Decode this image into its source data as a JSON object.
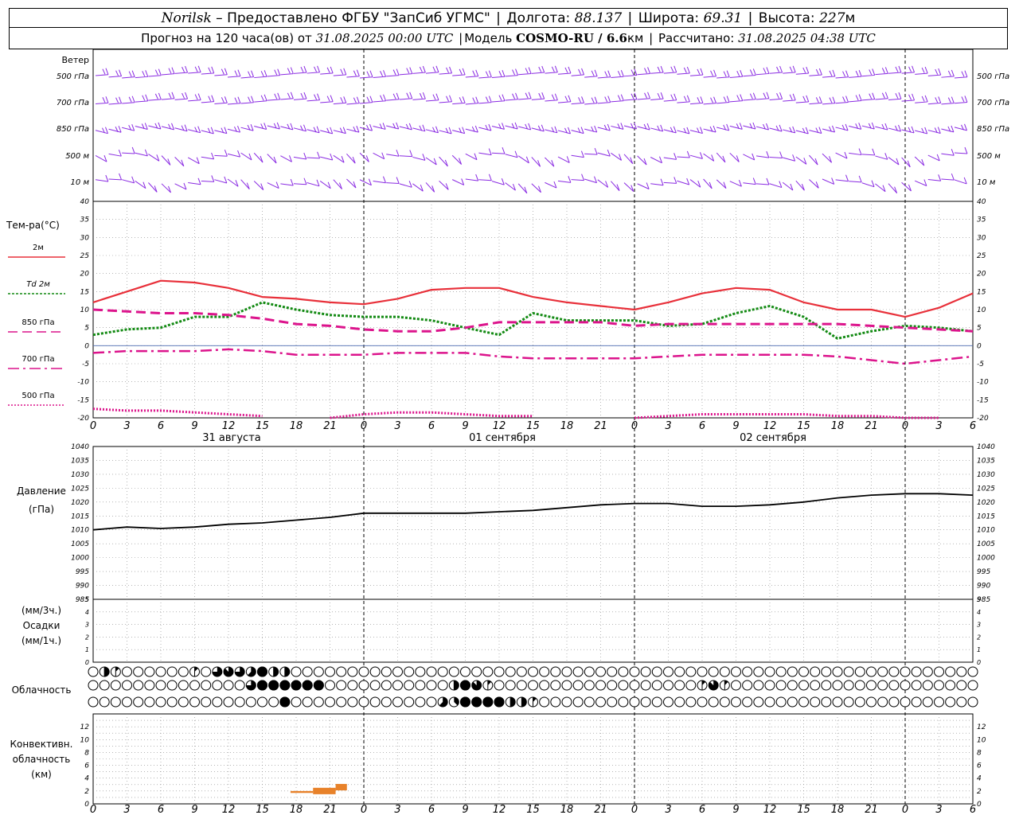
{
  "header": {
    "line1": {
      "station": "Norilsk",
      "dash": " – ",
      "provider": "Предоставлено ФГБУ \"ЗапСиб УГМС\"",
      "lon_label": "Долгота:",
      "lon_value": "88.137",
      "lat_label": "Широта:",
      "lat_value": "69.31",
      "alt_label": "Высота:",
      "alt_value": "227",
      "alt_unit": "м"
    },
    "line2": {
      "forecast_label": "Прогноз на 120 часа(ов) от",
      "forecast_start": "31.08.2025 00:00 UTC",
      "model_label": "Модель",
      "model_name": "COSMO-RU / 6.6",
      "model_unit": "км",
      "computed_label": "Рассчитано:",
      "computed_value": "31.08.2025 04:38 UTC"
    }
  },
  "wind_panel": {
    "title": "Ветер",
    "levels": [
      "500 гПа",
      "700 гПа",
      "850 гПа",
      "500 м",
      "10  м"
    ],
    "barb_color": "#8a2be2"
  },
  "chart_data": [
    {
      "type": "line",
      "panel": "temperature",
      "ylabel": "Тем-ра(°C)",
      "ylim": [
        -20,
        40
      ],
      "yticks": [
        "40",
        "35",
        "30",
        "25",
        "20",
        "15",
        "10",
        "5",
        "0",
        "-5",
        "-10",
        "-15",
        "-20"
      ],
      "x": [
        0,
        3,
        6,
        9,
        12,
        15,
        18,
        21,
        24,
        27,
        30,
        33,
        36,
        39,
        42,
        45,
        48,
        51,
        54,
        57,
        60,
        63,
        66,
        69,
        72,
        75,
        78
      ],
      "x_tick_labels": [
        "0",
        "3",
        "6",
        "9",
        "12",
        "15",
        "18",
        "21",
        "0",
        "3",
        "6",
        "9",
        "12",
        "15",
        "18",
        "21",
        "0",
        "3",
        "6",
        "9",
        "12",
        "15",
        "18",
        "21",
        "0",
        "3",
        "6"
      ],
      "day_labels": [
        "31 августа",
        "01 сентября",
        "02 сентября"
      ],
      "series": [
        {
          "name": "2м",
          "color": "#e8303a",
          "style": "solid",
          "values": [
            12,
            15,
            18,
            17.5,
            16,
            13.5,
            13,
            12,
            11.5,
            13,
            15.5,
            16,
            16,
            13.5,
            12,
            11,
            10,
            12,
            14.5,
            16,
            15.5,
            12,
            10,
            10,
            8,
            10.5,
            14.5
          ]
        },
        {
          "name": "Td 2м",
          "color": "#138a13",
          "style": "dotted",
          "values": [
            3,
            4.5,
            5,
            8,
            8,
            12,
            10,
            8.5,
            8,
            8,
            7,
            5,
            3,
            9,
            7,
            7,
            7,
            5.5,
            6,
            9,
            11,
            8,
            2,
            4,
            5.5,
            5,
            4
          ]
        },
        {
          "name": "850 гПа",
          "color": "#dc148c",
          "style": "dashed",
          "values": [
            10,
            9.5,
            9,
            9,
            8.5,
            7.5,
            6,
            5.5,
            4.5,
            4,
            4,
            5,
            6.5,
            6.5,
            6.5,
            6.5,
            5.5,
            6,
            6,
            6,
            6,
            6,
            6,
            5.5,
            5,
            4.5,
            4
          ]
        },
        {
          "name": "700 гПа",
          "color": "#dc148c",
          "style": "dashdot",
          "values": [
            -2,
            -1.5,
            -1.5,
            -1.5,
            -1,
            -1.5,
            -2.5,
            -2.5,
            -2.5,
            -2,
            -2,
            -2,
            -3,
            -3.5,
            -3.5,
            -3.5,
            -3.5,
            -3,
            -2.5,
            -2.5,
            -2.5,
            -2.5,
            -3,
            -4,
            -5,
            -4,
            -3
          ]
        },
        {
          "name": "500 гПа",
          "color": "#dc148c",
          "style": "dotted-fine",
          "values": [
            -17.5,
            -18,
            -18,
            -18.5,
            -19,
            -19.5,
            null,
            -20,
            -19,
            -18.5,
            -18.5,
            -19,
            -19.5,
            -19.5,
            null,
            null,
            -20,
            -19.5,
            -19,
            -19,
            -19,
            -19,
            -19.5,
            -19.5,
            -20,
            -20,
            null
          ]
        }
      ]
    },
    {
      "type": "line",
      "panel": "pressure",
      "ylabel": "Давление",
      "yunit": "(гПа)",
      "ylim": [
        985,
        1040
      ],
      "yticks": [
        "1040",
        "1035",
        "1030",
        "1025",
        "1020",
        "1015",
        "1010",
        "1005",
        "1000",
        "995",
        "990",
        "985"
      ],
      "x": [
        0,
        3,
        6,
        9,
        12,
        15,
        18,
        21,
        24,
        27,
        30,
        33,
        36,
        39,
        42,
        45,
        48,
        51,
        54,
        57,
        60,
        63,
        66,
        69,
        72,
        75,
        78
      ],
      "series": [
        {
          "name": "Давление",
          "color": "#000000",
          "values": [
            1010,
            1011,
            1010.5,
            1011,
            1012,
            1012.5,
            1013.5,
            1014.5,
            1016,
            1016,
            1016,
            1016,
            1016.5,
            1017,
            1018,
            1019,
            1019.5,
            1019.5,
            1018.5,
            1018.5,
            1019,
            1020,
            1021.5,
            1022.5,
            1023,
            1023,
            1022.5
          ]
        }
      ]
    },
    {
      "type": "bar",
      "panel": "precipitation",
      "ylabel_lines": [
        "(мм/3ч.)",
        "Осадки",
        "(мм/1ч.)"
      ],
      "ylim": [
        0,
        5
      ],
      "yticks": [
        "5",
        "4",
        "3",
        "2",
        "1",
        "0"
      ],
      "values": []
    },
    {
      "type": "table",
      "panel": "cloudiness",
      "ylabel": "Облачность",
      "hours": [
        0,
        1,
        2,
        3,
        4,
        5,
        6,
        7,
        8,
        9,
        10,
        11,
        12,
        13,
        14,
        15,
        16,
        17,
        18,
        19,
        20,
        21,
        22,
        23,
        24,
        25,
        26,
        27,
        28,
        29,
        30,
        31,
        32,
        33,
        34,
        35,
        36,
        37,
        38,
        39,
        40,
        41,
        42,
        43,
        44,
        45,
        46,
        47,
        48,
        49,
        50,
        51,
        52,
        53,
        54,
        55,
        56,
        57,
        58,
        59,
        60,
        61,
        62,
        63,
        64,
        65,
        66,
        67,
        68,
        69,
        70,
        71,
        72,
        73,
        74,
        75,
        76,
        77,
        78
      ],
      "rows": [
        [
          0,
          0.5,
          0.125,
          0,
          0,
          0,
          0,
          0,
          0,
          0.125,
          0,
          0.75,
          0.875,
          0.75,
          0.625,
          1,
          0.5,
          0.5,
          0,
          0,
          0,
          0,
          0,
          0,
          0,
          0,
          0,
          0,
          0,
          0,
          0,
          0,
          0,
          0,
          0,
          0,
          0,
          0,
          0,
          0,
          0,
          0,
          0,
          0,
          0,
          0,
          0,
          0,
          0,
          0,
          0,
          0,
          0,
          0,
          0,
          0,
          0,
          0,
          0,
          0,
          0,
          0,
          0,
          0,
          0,
          0,
          0,
          0,
          0,
          0,
          0,
          0,
          0,
          0,
          0,
          0,
          0,
          0,
          0
        ],
        [
          0,
          0,
          0,
          0,
          0,
          0,
          0,
          0,
          0,
          0,
          0,
          0,
          0,
          0,
          0.75,
          1,
          1,
          1,
          1,
          1,
          1,
          0,
          0,
          0,
          0,
          0,
          0,
          0,
          0,
          0,
          0,
          0,
          0.5,
          1,
          0.875,
          0.125,
          0,
          0,
          0,
          0,
          0,
          0,
          0,
          0,
          0,
          0,
          0,
          0,
          0,
          0,
          0,
          0,
          0,
          0,
          0.125,
          0.875,
          0.125,
          0,
          0,
          0,
          0,
          0,
          0,
          0,
          0,
          0,
          0,
          0,
          0,
          0,
          0,
          0,
          0,
          0,
          0,
          0,
          0,
          0,
          0
        ],
        [
          0,
          0,
          0,
          0,
          0,
          0,
          0,
          0,
          0,
          0,
          0,
          0,
          0,
          0,
          0,
          0,
          0,
          1,
          0,
          0,
          0,
          0,
          0,
          0,
          0,
          0,
          0,
          0,
          0,
          0,
          0,
          0.625,
          0.375,
          1,
          1,
          1,
          1,
          0.5,
          0.5,
          0.125,
          0,
          0,
          0,
          0,
          0,
          0,
          0,
          0,
          0,
          0,
          0,
          0,
          0,
          0,
          0,
          0,
          0,
          0,
          0,
          0,
          0,
          0,
          0,
          0,
          0,
          0,
          0,
          0,
          0,
          0,
          0,
          0,
          0,
          0,
          0,
          0,
          0,
          0,
          0
        ]
      ]
    },
    {
      "type": "bar",
      "panel": "convective_clouds",
      "ylabel_lines": [
        "Конвективн.",
        "облачность",
        "(км)"
      ],
      "ylim": [
        0,
        14
      ],
      "yticks": [
        "12",
        "10",
        "8",
        "6",
        "4",
        "2",
        "0"
      ],
      "color": "#e8822a",
      "bars": [
        {
          "x0": 17.5,
          "x1": 19.5,
          "base": 1.7,
          "top": 2.0
        },
        {
          "x0": 19.5,
          "x1": 21.5,
          "base": 1.5,
          "top": 2.5
        },
        {
          "x0": 21.5,
          "x1": 22.5,
          "base": 2.1,
          "top": 3.1
        }
      ]
    }
  ]
}
